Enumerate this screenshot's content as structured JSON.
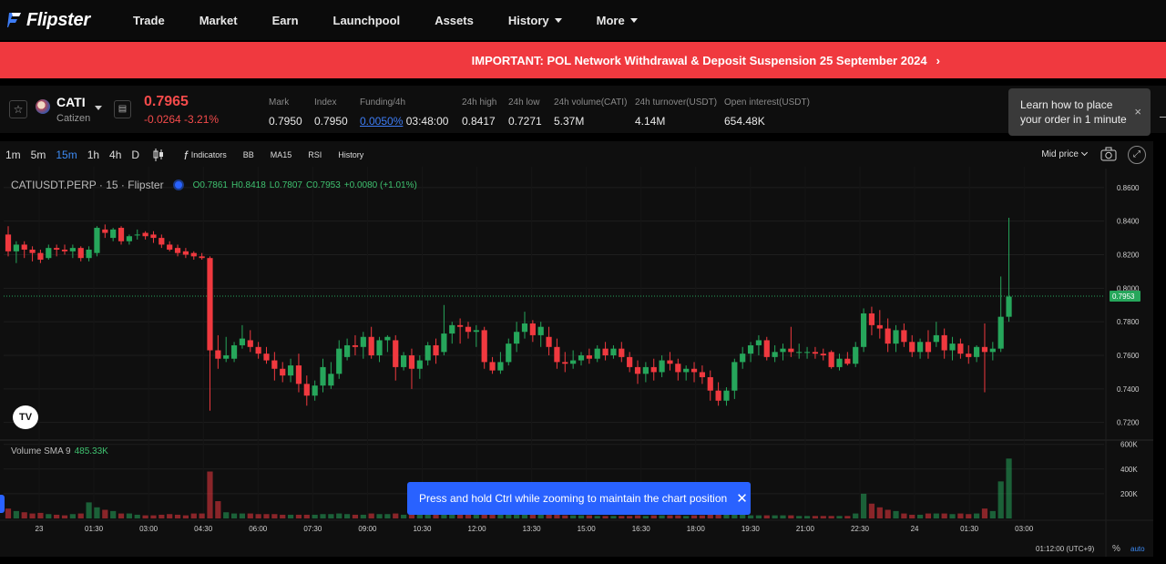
{
  "brand": {
    "name": "Flipster"
  },
  "nav": {
    "items": [
      "Trade",
      "Market",
      "Earn",
      "Launchpool",
      "Assets"
    ],
    "history_label": "History",
    "more_label": "More"
  },
  "banner": {
    "text": "IMPORTANT:  POL Network Withdrawal & Deposit Suspension 25 September 2024",
    "chevron": "›"
  },
  "ticker": {
    "symbol": "CATI",
    "name": "Catizen",
    "price": "0.7965",
    "change": "-0.0264 -3.21%",
    "mark_label": "Mark",
    "mark_value": "0.7950",
    "index_label": "Index",
    "index_value": "0.7950",
    "funding_label": "Funding/4h",
    "funding_rate": "0.0050%",
    "funding_countdown": "03:48:00",
    "high_label": "24h high",
    "high_value": "0.8417",
    "low_label": "24h low",
    "low_value": "0.7271",
    "volume_label": "24h volume(CATI)",
    "volume_value": "5.37M",
    "turnover_label": "24h turnover(USDT)",
    "turnover_value": "4.14M",
    "oi_label": "Open interest(USDT)",
    "oi_value": "654.48K"
  },
  "tooltip": {
    "line1": "Learn how to place",
    "line2": "your order in 1 minute",
    "close": "×"
  },
  "toolbar": {
    "timeframes": [
      "1m",
      "5m",
      "15m",
      "1h",
      "4h",
      "D"
    ],
    "active_timeframe": "15m",
    "indicators_label": "Indicators",
    "fx_label": "f",
    "studies": [
      "BB",
      "MA15",
      "RSI",
      "History"
    ],
    "price_source": "Mid price"
  },
  "legend": {
    "title": "CATIUSDT.PERP · 15 · Flipster",
    "open": "0.7861",
    "high": "0.8418",
    "low": "0.7807",
    "close": "0.7953",
    "change": "+0.0080 (+1.01%)"
  },
  "volume_legend": {
    "label": "Volume SMA 9",
    "value": "485.33K"
  },
  "toast": {
    "text": "Press and hold Ctrl while zooming to maintain the chart position",
    "close": "✕"
  },
  "footer": {
    "time": "01:12:00 (UTC+9)",
    "percent": "%",
    "auto": "auto"
  },
  "colors": {
    "up": "#26a65b",
    "down": "#f0393f",
    "accent": "#2962ff",
    "banner": "#f0393f"
  },
  "chart_data": {
    "type": "candlestick",
    "symbol": "CATIUSDT.PERP",
    "interval": "15",
    "price_axis": {
      "ticks": [
        "0.8600",
        "0.8400",
        "0.8200",
        "0.8000",
        "0.7800",
        "0.7600",
        "0.7400",
        "0.7200"
      ],
      "range": [
        0.7106,
        0.8724
      ]
    },
    "last_price_label": "0.7953",
    "volume_axis": {
      "ticks": [
        "600K",
        "400K",
        "200K"
      ],
      "range": [
        0,
        620000
      ]
    },
    "time_axis": {
      "ticks": [
        "23",
        "01:30",
        "03:00",
        "04:30",
        "06:00",
        "07:30",
        "09:00",
        "10:30",
        "12:00",
        "13:30",
        "15:00",
        "16:30",
        "18:00",
        "19:30",
        "21:00",
        "22:30",
        "24",
        "01:30",
        "03:00"
      ]
    },
    "candles": [
      [
        0.832,
        0.837,
        0.819,
        0.822,
        80000
      ],
      [
        0.822,
        0.828,
        0.815,
        0.826,
        60000
      ],
      [
        0.826,
        0.828,
        0.818,
        0.823,
        50000
      ],
      [
        0.823,
        0.825,
        0.816,
        0.821,
        40000
      ],
      [
        0.821,
        0.823,
        0.815,
        0.817,
        45000
      ],
      [
        0.818,
        0.826,
        0.817,
        0.824,
        35000
      ],
      [
        0.824,
        0.826,
        0.819,
        0.823,
        30000
      ],
      [
        0.823,
        0.826,
        0.82,
        0.822,
        25000
      ],
      [
        0.822,
        0.826,
        0.818,
        0.824,
        35000
      ],
      [
        0.824,
        0.825,
        0.816,
        0.818,
        40000
      ],
      [
        0.818,
        0.825,
        0.816,
        0.823,
        130000
      ],
      [
        0.821,
        0.837,
        0.819,
        0.836,
        90000
      ],
      [
        0.835,
        0.838,
        0.83,
        0.833,
        70000
      ],
      [
        0.83,
        0.836,
        0.828,
        0.835,
        60000
      ],
      [
        0.836,
        0.837,
        0.826,
        0.828,
        40000
      ],
      [
        0.828,
        0.832,
        0.826,
        0.831,
        40000
      ],
      [
        0.832,
        0.835,
        0.829,
        0.832,
        30000
      ],
      [
        0.833,
        0.834,
        0.829,
        0.831,
        25000
      ],
      [
        0.832,
        0.834,
        0.827,
        0.83,
        25000
      ],
      [
        0.83,
        0.832,
        0.824,
        0.826,
        30000
      ],
      [
        0.826,
        0.828,
        0.822,
        0.823,
        35000
      ],
      [
        0.824,
        0.826,
        0.819,
        0.821,
        30000
      ],
      [
        0.822,
        0.824,
        0.818,
        0.82,
        25000
      ],
      [
        0.821,
        0.822,
        0.817,
        0.819,
        40000
      ],
      [
        0.819,
        0.821,
        0.817,
        0.818,
        40000
      ],
      [
        0.818,
        0.819,
        0.727,
        0.763,
        380000
      ],
      [
        0.763,
        0.772,
        0.752,
        0.758,
        140000
      ],
      [
        0.758,
        0.771,
        0.756,
        0.76,
        50000
      ],
      [
        0.758,
        0.768,
        0.756,
        0.766,
        40000
      ],
      [
        0.766,
        0.778,
        0.764,
        0.77,
        40000
      ],
      [
        0.769,
        0.775,
        0.762,
        0.765,
        40000
      ],
      [
        0.765,
        0.768,
        0.758,
        0.761,
        35000
      ],
      [
        0.761,
        0.765,
        0.755,
        0.757,
        35000
      ],
      [
        0.757,
        0.762,
        0.745,
        0.752,
        35000
      ],
      [
        0.752,
        0.756,
        0.744,
        0.748,
        30000
      ],
      [
        0.748,
        0.758,
        0.744,
        0.754,
        30000
      ],
      [
        0.754,
        0.761,
        0.738,
        0.743,
        30000
      ],
      [
        0.743,
        0.748,
        0.73,
        0.736,
        30000
      ],
      [
        0.736,
        0.745,
        0.733,
        0.742,
        30000
      ],
      [
        0.742,
        0.758,
        0.738,
        0.753,
        35000
      ],
      [
        0.742,
        0.756,
        0.74,
        0.749,
        35000
      ],
      [
        0.749,
        0.769,
        0.746,
        0.764,
        40000
      ],
      [
        0.759,
        0.77,
        0.757,
        0.766,
        35000
      ],
      [
        0.766,
        0.772,
        0.76,
        0.765,
        30000
      ],
      [
        0.765,
        0.774,
        0.758,
        0.771,
        30000
      ],
      [
        0.771,
        0.777,
        0.758,
        0.76,
        40000
      ],
      [
        0.76,
        0.771,
        0.756,
        0.769,
        35000
      ],
      [
        0.769,
        0.772,
        0.762,
        0.771,
        35000
      ],
      [
        0.769,
        0.772,
        0.745,
        0.753,
        40000
      ],
      [
        0.753,
        0.762,
        0.751,
        0.76,
        30000
      ],
      [
        0.76,
        0.764,
        0.74,
        0.752,
        35000
      ],
      [
        0.752,
        0.76,
        0.746,
        0.757,
        30000
      ],
      [
        0.757,
        0.768,
        0.754,
        0.766,
        30000
      ],
      [
        0.766,
        0.77,
        0.755,
        0.76,
        30000
      ],
      [
        0.762,
        0.79,
        0.76,
        0.773,
        40000
      ],
      [
        0.773,
        0.78,
        0.767,
        0.778,
        35000
      ],
      [
        0.778,
        0.782,
        0.767,
        0.777,
        30000
      ],
      [
        0.777,
        0.78,
        0.77,
        0.774,
        35000
      ],
      [
        0.774,
        0.778,
        0.765,
        0.775,
        30000
      ],
      [
        0.775,
        0.777,
        0.752,
        0.756,
        40000
      ],
      [
        0.756,
        0.759,
        0.749,
        0.751,
        30000
      ],
      [
        0.751,
        0.762,
        0.749,
        0.756,
        35000
      ],
      [
        0.756,
        0.77,
        0.754,
        0.767,
        35000
      ],
      [
        0.767,
        0.78,
        0.762,
        0.774,
        35000
      ],
      [
        0.774,
        0.786,
        0.77,
        0.779,
        30000
      ],
      [
        0.779,
        0.781,
        0.768,
        0.772,
        30000
      ],
      [
        0.772,
        0.78,
        0.765,
        0.777,
        35000
      ],
      [
        0.771,
        0.777,
        0.76,
        0.765,
        30000
      ],
      [
        0.765,
        0.77,
        0.752,
        0.756,
        30000
      ],
      [
        0.756,
        0.762,
        0.75,
        0.755,
        25000
      ],
      [
        0.755,
        0.763,
        0.752,
        0.757,
        25000
      ],
      [
        0.757,
        0.762,
        0.754,
        0.76,
        25000
      ],
      [
        0.76,
        0.764,
        0.755,
        0.758,
        25000
      ],
      [
        0.758,
        0.766,
        0.756,
        0.764,
        20000
      ],
      [
        0.764,
        0.768,
        0.757,
        0.76,
        20000
      ],
      [
        0.76,
        0.766,
        0.758,
        0.764,
        20000
      ],
      [
        0.764,
        0.768,
        0.756,
        0.759,
        20000
      ],
      [
        0.759,
        0.762,
        0.75,
        0.753,
        20000
      ],
      [
        0.753,
        0.757,
        0.743,
        0.749,
        25000
      ],
      [
        0.749,
        0.756,
        0.744,
        0.753,
        20000
      ],
      [
        0.753,
        0.758,
        0.745,
        0.75,
        25000
      ],
      [
        0.75,
        0.76,
        0.747,
        0.757,
        25000
      ],
      [
        0.757,
        0.762,
        0.751,
        0.755,
        25000
      ],
      [
        0.755,
        0.758,
        0.745,
        0.75,
        25000
      ],
      [
        0.75,
        0.754,
        0.745,
        0.752,
        20000
      ],
      [
        0.752,
        0.756,
        0.744,
        0.75,
        25000
      ],
      [
        0.75,
        0.754,
        0.743,
        0.747,
        25000
      ],
      [
        0.747,
        0.751,
        0.733,
        0.739,
        30000
      ],
      [
        0.739,
        0.744,
        0.73,
        0.733,
        35000
      ],
      [
        0.733,
        0.741,
        0.73,
        0.739,
        30000
      ],
      [
        0.739,
        0.758,
        0.734,
        0.756,
        35000
      ],
      [
        0.756,
        0.765,
        0.752,
        0.761,
        30000
      ],
      [
        0.761,
        0.768,
        0.756,
        0.766,
        25000
      ],
      [
        0.766,
        0.772,
        0.76,
        0.769,
        25000
      ],
      [
        0.769,
        0.771,
        0.757,
        0.759,
        25000
      ],
      [
        0.759,
        0.766,
        0.756,
        0.762,
        25000
      ],
      [
        0.762,
        0.767,
        0.757,
        0.764,
        25000
      ],
      [
        0.764,
        0.777,
        0.759,
        0.762,
        25000
      ],
      [
        0.762,
        0.767,
        0.758,
        0.762,
        20000
      ],
      [
        0.762,
        0.765,
        0.758,
        0.762,
        20000
      ],
      [
        0.762,
        0.765,
        0.758,
        0.761,
        20000
      ],
      [
        0.761,
        0.764,
        0.757,
        0.76,
        20000
      ],
      [
        0.762,
        0.763,
        0.752,
        0.753,
        20000
      ],
      [
        0.753,
        0.761,
        0.751,
        0.758,
        20000
      ],
      [
        0.758,
        0.762,
        0.754,
        0.755,
        20000
      ],
      [
        0.755,
        0.768,
        0.753,
        0.765,
        40000
      ],
      [
        0.765,
        0.788,
        0.762,
        0.785,
        200000
      ],
      [
        0.785,
        0.789,
        0.772,
        0.778,
        120000
      ],
      [
        0.778,
        0.787,
        0.77,
        0.776,
        90000
      ],
      [
        0.776,
        0.782,
        0.762,
        0.767,
        70000
      ],
      [
        0.767,
        0.778,
        0.762,
        0.775,
        60000
      ],
      [
        0.775,
        0.779,
        0.765,
        0.768,
        40000
      ],
      [
        0.768,
        0.772,
        0.759,
        0.762,
        30000
      ],
      [
        0.762,
        0.77,
        0.758,
        0.768,
        30000
      ],
      [
        0.768,
        0.775,
        0.758,
        0.762,
        40000
      ],
      [
        0.768,
        0.78,
        0.765,
        0.772,
        40000
      ],
      [
        0.772,
        0.776,
        0.758,
        0.763,
        40000
      ],
      [
        0.763,
        0.771,
        0.757,
        0.767,
        35000
      ],
      [
        0.767,
        0.77,
        0.758,
        0.761,
        40000
      ],
      [
        0.761,
        0.766,
        0.755,
        0.759,
        35000
      ],
      [
        0.759,
        0.766,
        0.756,
        0.765,
        40000
      ],
      [
        0.765,
        0.779,
        0.738,
        0.762,
        80000
      ],
      [
        0.762,
        0.768,
        0.757,
        0.764,
        60000
      ],
      [
        0.764,
        0.807,
        0.762,
        0.783,
        300000
      ],
      [
        0.783,
        0.842,
        0.78,
        0.795,
        485000
      ]
    ]
  }
}
